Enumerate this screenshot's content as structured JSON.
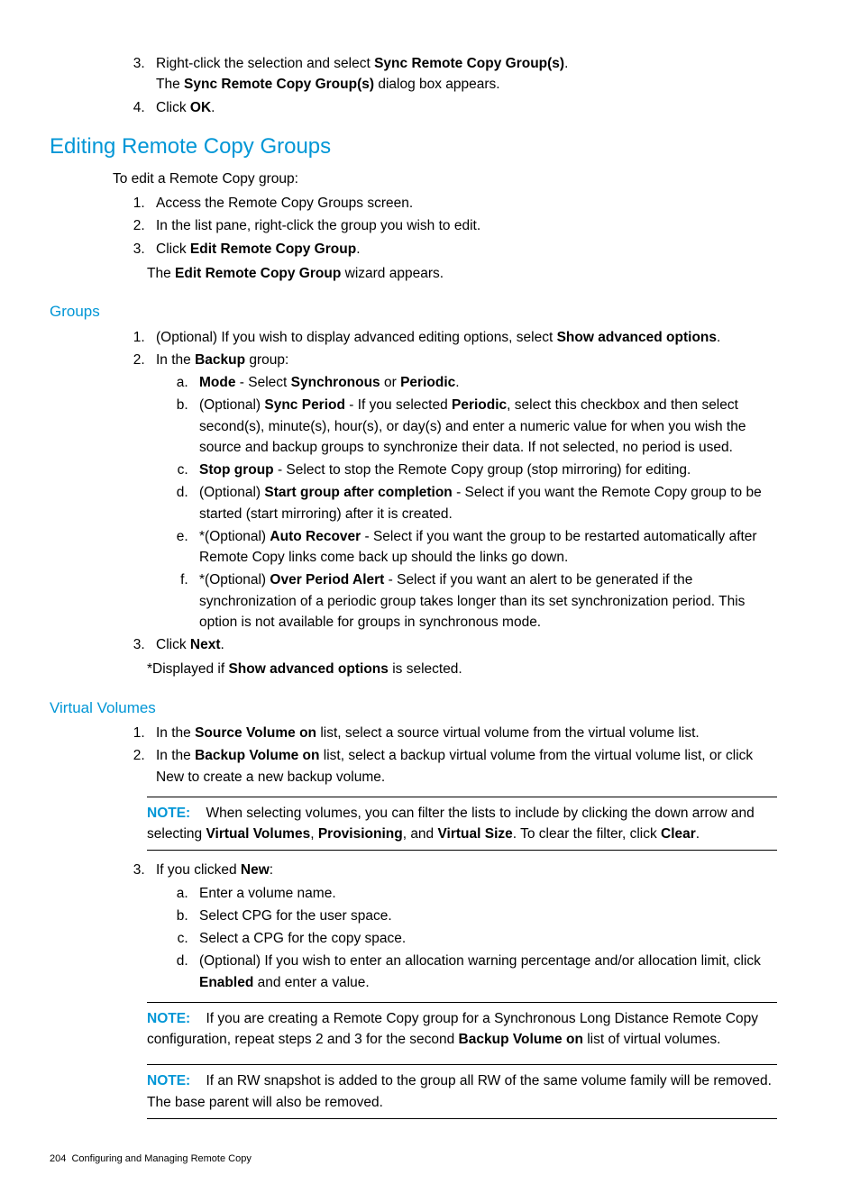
{
  "top_steps": {
    "s3_a": "Right-click the selection and select ",
    "s3_bold": "Sync Remote Copy Group(s)",
    "s3_b": ".",
    "s3_sub_a": "The ",
    "s3_sub_bold": "Sync Remote Copy Group(s)",
    "s3_sub_b": " dialog box appears.",
    "s4_a": "Click ",
    "s4_bold": "OK",
    "s4_b": "."
  },
  "edit_heading": "Editing Remote Copy Groups",
  "edit_intro": "To edit a Remote Copy group:",
  "edit_steps": {
    "s1": "Access the Remote Copy Groups screen.",
    "s2": "In the list pane, right-click the group you wish to edit.",
    "s3_a": "Click ",
    "s3_bold": "Edit Remote Copy Group",
    "s3_b": "."
  },
  "edit_after_a": "The ",
  "edit_after_bold": "Edit Remote Copy Group",
  "edit_after_b": " wizard appears.",
  "groups_heading": "Groups",
  "groups": {
    "s1_a": "(Optional) If you wish to display advanced editing options, select ",
    "s1_bold": "Show advanced options",
    "s1_b": ".",
    "s2_a": "In the ",
    "s2_bold": "Backup",
    "s2_b": " group:",
    "s2a_bold1": "Mode",
    "s2a_mid": " - Select ",
    "s2a_bold2": "Synchronous",
    "s2a_or": " or ",
    "s2a_bold3": "Periodic",
    "s2a_end": ".",
    "s2b_pre": "(Optional) ",
    "s2b_bold1": "Sync Period",
    "s2b_mid": " - If you selected ",
    "s2b_bold2": "Periodic",
    "s2b_rest": ", select this checkbox and then select second(s), minute(s), hour(s), or day(s) and enter a numeric value for when you wish the source and backup groups to synchronize their data. If not selected, no period is used.",
    "s2c_bold": "Stop group",
    "s2c_rest": " - Select to stop the Remote Copy group (stop mirroring) for editing.",
    "s2d_pre": "(Optional) ",
    "s2d_bold": "Start group after completion",
    "s2d_rest": " - Select if you want the Remote Copy group to be started (start mirroring) after it is created.",
    "s2e_pre": "*(Optional) ",
    "s2e_bold": "Auto Recover",
    "s2e_rest": " - Select if you want the group to be restarted automatically after Remote Copy links come back up should the links go down.",
    "s2f_pre": "*(Optional) ",
    "s2f_bold": "Over Period Alert",
    "s2f_rest": " - Select if you want an alert to be generated if the synchronization of a periodic group takes longer than its set synchronization period. This option is not available for groups in synchronous mode.",
    "s3_a": "Click ",
    "s3_bold": "Next",
    "s3_b": "."
  },
  "groups_after_a": "*Displayed if ",
  "groups_after_bold": "Show advanced options",
  "groups_after_b": " is selected.",
  "vv_heading": "Virtual Volumes",
  "vv": {
    "s1_a": "In the ",
    "s1_bold": "Source Volume on",
    "s1_b": " list, select a source virtual volume from the virtual volume list.",
    "s2_a": "In the ",
    "s2_bold": "Backup Volume on",
    "s2_b": " list, select a backup virtual volume from the virtual volume list, or click New to create a new backup volume.",
    "note1_label": "NOTE:",
    "note1_a": "When selecting volumes, you can filter the lists to include by clicking the down arrow and selecting ",
    "note1_b1": "Virtual Volumes",
    "note1_c1": ", ",
    "note1_b2": "Provisioning",
    "note1_c2": ", and ",
    "note1_b3": "Virtual Size",
    "note1_c3": ". To clear the filter, click ",
    "note1_b4": "Clear",
    "note1_c4": ".",
    "s3_a": "If you clicked ",
    "s3_bold": "New",
    "s3_b": ":",
    "s3a": "Enter a volume name.",
    "s3b": "Select CPG for the user space.",
    "s3c": "Select a CPG for the copy space.",
    "s3d_a": "(Optional) If you wish to enter an allocation warning percentage and/or allocation limit, click ",
    "s3d_bold": "Enabled",
    "s3d_b": " and enter a value.",
    "note2_label": "NOTE:",
    "note2_a": "If you are creating a Remote Copy group for a Synchronous Long Distance Remote Copy configuration, repeat steps 2 and 3 for the second ",
    "note2_bold": "Backup Volume on",
    "note2_b": " list of virtual volumes.",
    "note3_label": "NOTE:",
    "note3_text": "If an RW snapshot is added to the group all RW of the same volume family will be removed. The base parent will also be removed."
  },
  "footer_page": "204",
  "footer_text": "Configuring and Managing Remote Copy"
}
